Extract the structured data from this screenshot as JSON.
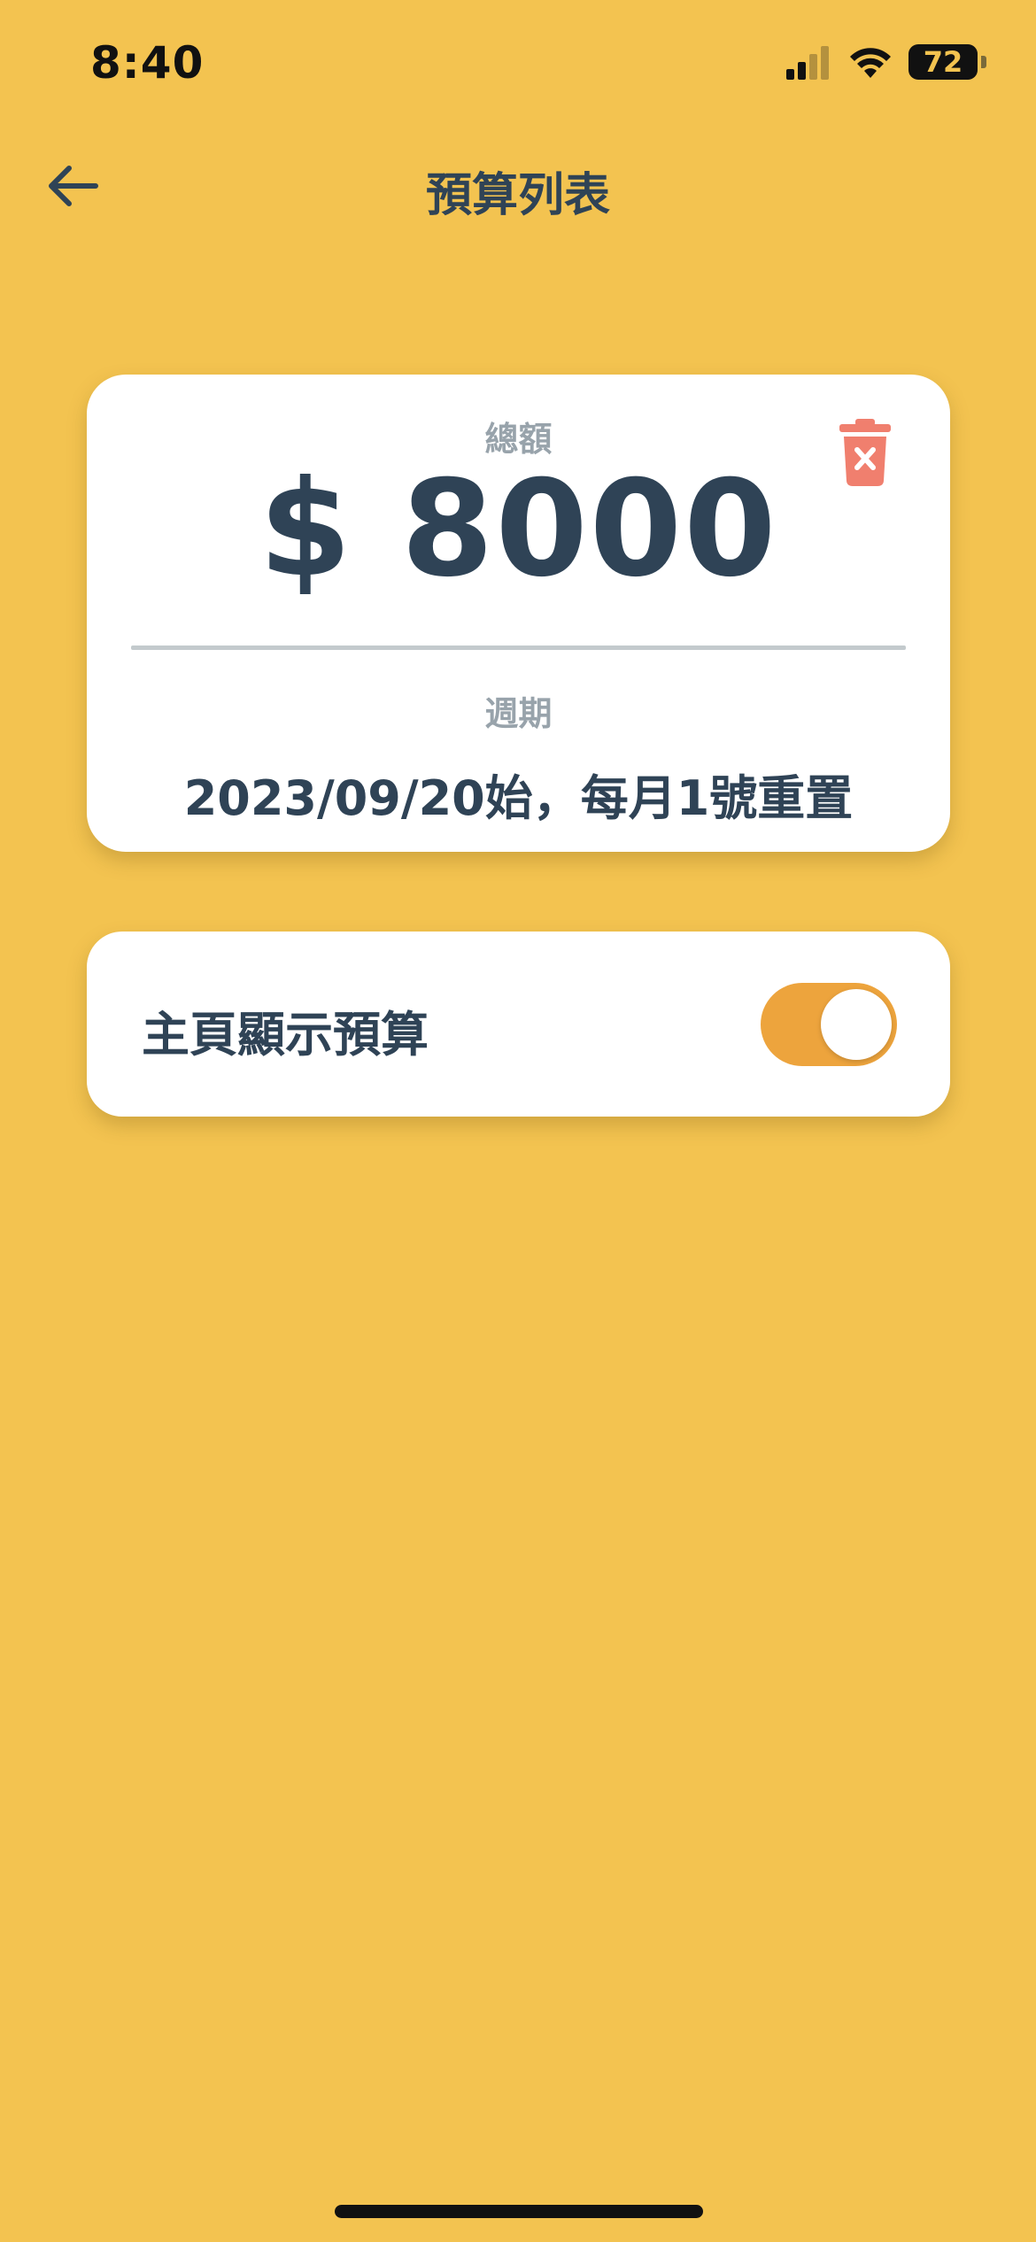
{
  "status_bar": {
    "time": "8:40",
    "battery_level": "72",
    "signal_icon": "signal-bars-icon",
    "wifi_icon": "wifi-icon"
  },
  "header": {
    "back_icon": "arrow-left-icon",
    "title": "預算列表"
  },
  "budget_card": {
    "total_label": "總額",
    "amount": "$ 8000",
    "delete_icon": "trash-delete-icon",
    "period_label": "週期",
    "period_value": "2023/09/20始，每月1號重置"
  },
  "settings": {
    "show_on_home_label": "主頁顯示預算",
    "show_on_home_enabled": true
  },
  "colors": {
    "background": "#F3C350",
    "card": "#FFFFFF",
    "primary_text": "#2F4356",
    "secondary_text": "#98A3AB",
    "delete": "#F07F6E",
    "toggle_on": "#EDA43D"
  }
}
